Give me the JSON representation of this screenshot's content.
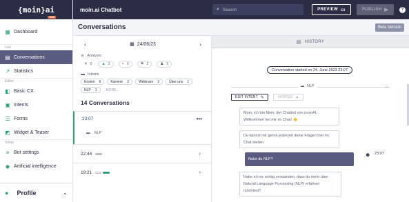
{
  "brand": {
    "logo": "{moin}ai",
    "badge": "HUB"
  },
  "sidebar": {
    "items": [
      {
        "label": "Dashboard",
        "icon": "dashboard-icon",
        "active": false
      },
      {
        "label": "Conversations",
        "icon": "chat-icon",
        "active": true
      },
      {
        "label": "Statistics",
        "icon": "chart-icon",
        "active": false
      },
      {
        "label": "Basic CX",
        "icon": "basic-cx-icon",
        "active": false
      },
      {
        "label": "Intents",
        "icon": "intents-icon",
        "active": false
      },
      {
        "label": "Forms",
        "icon": "forms-icon",
        "active": false
      },
      {
        "label": "Widget & Teaser",
        "icon": "widget-icon",
        "active": false
      },
      {
        "label": "Bot settings",
        "icon": "settings-icon",
        "active": false
      },
      {
        "label": "Artificial intelligence",
        "icon": "ai-icon",
        "active": false
      }
    ],
    "sections": {
      "live": "Live",
      "editor": "Editor",
      "setup": "Setup"
    },
    "profile_label": "Profile"
  },
  "topbar": {
    "title": "moin.ai Chatbot",
    "search_placeholder": "Search",
    "preview_label": "PREVIEW",
    "publish_label": "PUBLISH",
    "help": "?"
  },
  "page": {
    "title": "Conversations",
    "beta_label": "Beta Version"
  },
  "left": {
    "date": "24/06/23",
    "analysis_label": "Analysis",
    "stats": [
      {
        "icon": "neutral-icon",
        "value": "0"
      },
      {
        "icon": "thumbs-up-icon",
        "value": "2"
      },
      {
        "icon": "heart-icon",
        "value": "0"
      },
      {
        "icon": "flag-icon",
        "value": "2"
      },
      {
        "icon": "person-icon",
        "value": "5"
      }
    ],
    "intents_label": "Intents",
    "intents": [
      {
        "label": "Kosten",
        "count": "6"
      },
      {
        "label": "Karriere",
        "count": "3"
      },
      {
        "label": "Webinare",
        "count": "3"
      },
      {
        "label": "Über uns",
        "count": "1"
      },
      {
        "label": "NLP",
        "count": "1"
      }
    ],
    "more_label": "MORE...",
    "conversation_count": "14 Conversations",
    "conversations": [
      {
        "time": "23:07",
        "intent": "NLP"
      },
      {
        "time": "22:44"
      },
      {
        "time": "19:21"
      }
    ]
  },
  "right": {
    "history_label": "HISTORY",
    "started": "Conversation started on 24. June 2023 23:07",
    "intent_tag": "NLP",
    "edit_intent_label": "EDIT INTENT",
    "merken_label": "MERKEN",
    "messages": [
      {
        "text": "Moin, ich bin Moin: der Chatbot von moinAI. Willkommen bei mir im Chat! 👋",
        "from": "bot"
      },
      {
        "text": "Du kannst mir gerne jederzeit deine Fragen hier im Chat stellen.",
        "from": "bot"
      },
      {
        "text": "Nutzt du NLP?",
        "from": "user"
      },
      {
        "text": "Habe ich es richtig verstanden, dass du mehr über Natural Language Processing (NLP) erfahren möchtest?",
        "from": "bot"
      }
    ],
    "user_time": "23:07"
  },
  "colors": {
    "navy": "#2b2d45",
    "accent": "#2f9e7a",
    "active": "#595b80"
  }
}
